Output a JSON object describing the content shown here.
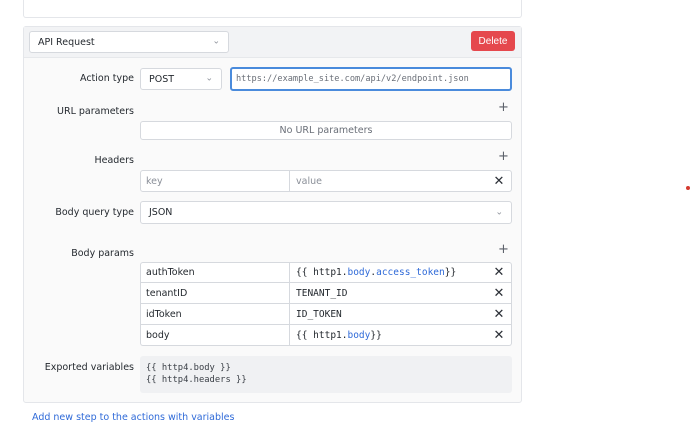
{
  "step_select": {
    "value": "API Request"
  },
  "delete_label": "Delete",
  "action_type": {
    "label": "Action type",
    "method": "POST",
    "url_placeholder": "https://example_site.com/api/v2/endpoint.json"
  },
  "url_params": {
    "label": "URL parameters",
    "empty_text": "No URL parameters"
  },
  "headers": {
    "label": "Headers",
    "key_placeholder": "key",
    "value_placeholder": "value"
  },
  "body_query_type": {
    "label": "Body query type",
    "value": "JSON"
  },
  "body_params": {
    "label": "Body params",
    "rows": [
      {
        "key": "authToken",
        "value_parts": [
          "{{ http1.",
          "body",
          ".",
          "access_token",
          " }}"
        ]
      },
      {
        "key": "tenantID",
        "value_parts": [
          "TENANT_ID"
        ]
      },
      {
        "key": "idToken",
        "value_parts": [
          "ID_TOKEN"
        ]
      },
      {
        "key": "body",
        "value_parts": [
          "{{ http1.",
          "body",
          " }}"
        ]
      }
    ]
  },
  "exported_variables": {
    "label": "Exported variables",
    "lines": [
      "{{ http4.body }}",
      "{{ http4.headers }}"
    ]
  },
  "bottom_link": "Add new step to the actions with variables",
  "colors": {
    "accent": "#4a8bdc",
    "danger": "#e5484d",
    "token": "#2f6ad8"
  },
  "icons": {
    "add": "plus-icon",
    "remove": "close-icon",
    "dropdown": "chevron-down-icon"
  }
}
